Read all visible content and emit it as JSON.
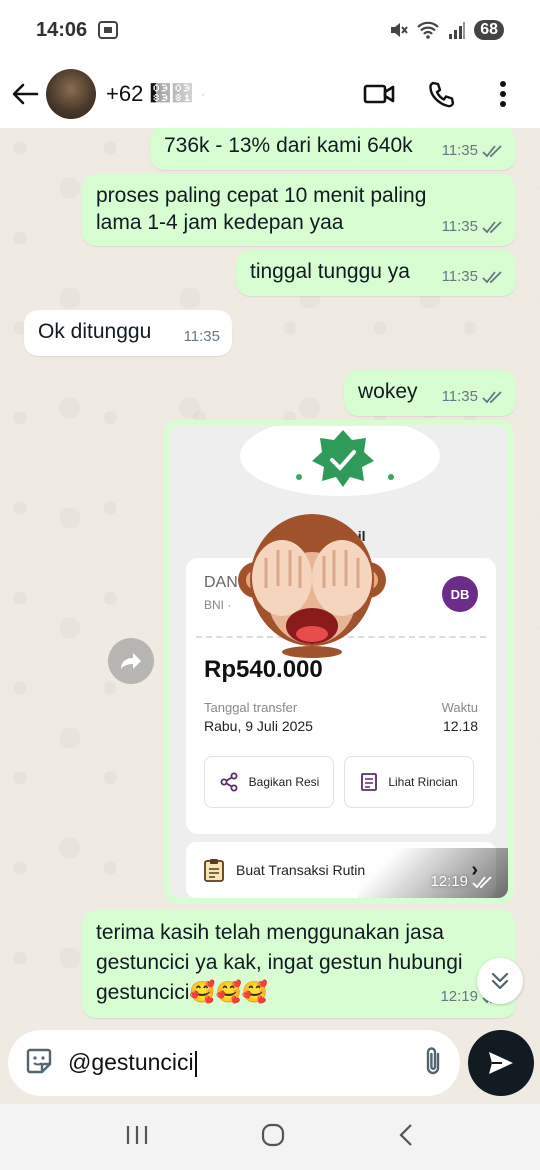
{
  "status_bar": {
    "time": "14:06",
    "battery": "68"
  },
  "header": {
    "contact_name": "+62 ΃΁ ·"
  },
  "messages": [
    {
      "text": "736k - 13% dari kami 640k",
      "time": "11:35",
      "direction": "out"
    },
    {
      "text": "proses paling cepat 10 menit paling lama 1-4 jam kedepan yaa",
      "time": "11:35",
      "direction": "out"
    },
    {
      "text": "tinggal tunggu ya",
      "time": "11:35",
      "direction": "out"
    },
    {
      "text": "Ok ditunggu",
      "time": "11:35",
      "direction": "in"
    },
    {
      "text": "wokey",
      "time": "11:35",
      "direction": "out"
    },
    {
      "text": "terima kasih telah menggunakan jasa gestuncici ya kak, ingat gestun hubungi gestuncici🥰🥰🥰",
      "time": "12:19",
      "direction": "out"
    }
  ],
  "receipt": {
    "status_text": "sil",
    "bank_name": "DAN",
    "bank_sub": "BNI ·",
    "initials": "DB",
    "amount": "Rp540.000",
    "date_label": "Tanggal transfer",
    "date_value": "Rabu, 9 Juli 2025",
    "time_label": "Waktu",
    "time_value": "12.18",
    "share_label": "Bagikan Resi",
    "detail_label": "Lihat Rincian",
    "routine_label": "Buat Transaksi Rutin",
    "sent_time": "12:19"
  },
  "input": {
    "value": "@gestuncici"
  },
  "icons": {
    "back": "arrow-left-icon",
    "video": "video-camera-icon",
    "phone": "phone-icon",
    "menu": "more-vertical-icon",
    "sticker": "sticker-icon",
    "attach": "paperclip-icon",
    "send": "send-icon",
    "forward": "forward-icon",
    "scroll_down": "double-chevron-down-icon"
  },
  "colors": {
    "outgoing_bubble": "#d9fdd3",
    "incoming_bubble": "#ffffff",
    "chat_background": "#efeae2",
    "send_button": "#111b21"
  }
}
